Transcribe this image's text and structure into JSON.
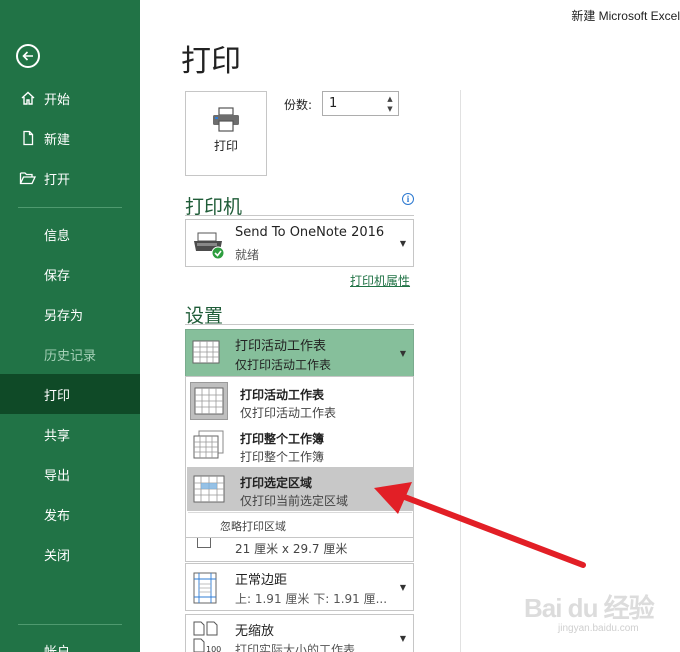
{
  "window": {
    "title": "新建 Microsoft Excel"
  },
  "sidebar": {
    "items": [
      {
        "label": "开始",
        "icon": "home-icon"
      },
      {
        "label": "新建",
        "icon": "new-document-icon"
      },
      {
        "label": "打开",
        "icon": "open-folder-icon"
      },
      {
        "label": "信息"
      },
      {
        "label": "保存"
      },
      {
        "label": "另存为"
      },
      {
        "label": "历史记录"
      },
      {
        "label": "打印"
      },
      {
        "label": "共享"
      },
      {
        "label": "导出"
      },
      {
        "label": "发布"
      },
      {
        "label": "关闭"
      },
      {
        "label": "帐户"
      }
    ],
    "active": "打印",
    "disabled": "历史记录"
  },
  "main": {
    "title": "打印",
    "print_button": "打印",
    "copies_label": "份数:",
    "copies_value": "1",
    "printer_section": "打印机",
    "printer": {
      "name": "Send To OneNote 2016",
      "status": "就绪"
    },
    "printer_properties": "打印机属性",
    "settings_section": "设置",
    "settings_selected": {
      "title": "打印活动工作表",
      "subtitle": "仅打印活动工作表"
    },
    "options": [
      {
        "title": "打印活动工作表",
        "subtitle": "仅打印活动工作表"
      },
      {
        "title": "打印整个工作簿",
        "subtitle": "打印整个工作簿"
      },
      {
        "title": "打印选定区域",
        "subtitle": "仅打印当前选定区域"
      }
    ],
    "ignore_print_area": "忽略打印区域",
    "paper_size": "21 厘米 x 29.7 厘米",
    "margins": {
      "title": "正常边距",
      "subtitle": "上: 1.91 厘米 下: 1.91 厘..."
    },
    "scaling": {
      "title": "无缩放",
      "subtitle": "打印实际大小的工作表"
    }
  },
  "watermark": {
    "logo": "Bai du 经验",
    "url": "jingyan.baidu.com"
  },
  "colors": {
    "sidebar": "#217346",
    "sidebar_active": "#0f4a27",
    "selected_dropdown": "#86bf9b",
    "arrow": "#e21f26"
  }
}
